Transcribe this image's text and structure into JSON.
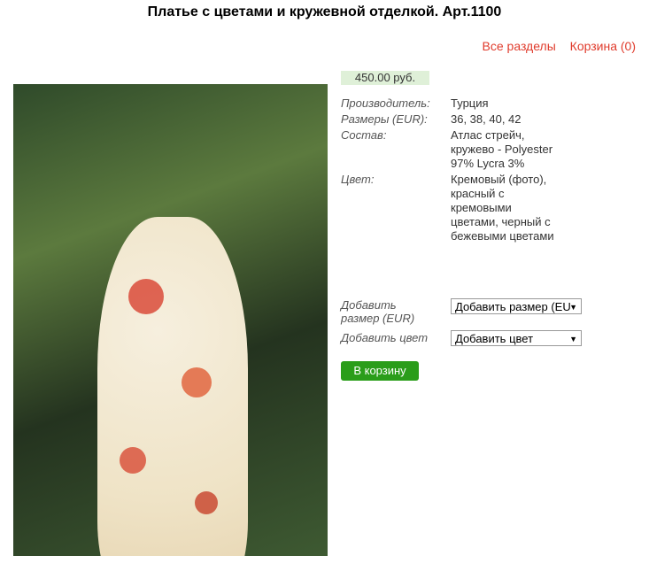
{
  "page": {
    "title": "Платье с цветами и кружевной отделкой. Арт.1100"
  },
  "nav": {
    "all_sections": "Все разделы",
    "cart": "Корзина (0)"
  },
  "product": {
    "price": "450.00 руб.",
    "specs": [
      {
        "label": "Производитель:",
        "value": "Турция"
      },
      {
        "label": "Размеры (EUR):",
        "value": "36, 38, 40, 42"
      },
      {
        "label": "Состав:",
        "value": "Атлас стрейч, кружево - Polyester 97% Lycra 3%"
      },
      {
        "label": "Цвет:",
        "value": "Кремовый (фото), красный с кремовыми цветами, черный с бежевыми цветами"
      }
    ],
    "add_size_label": "Добавить размер (EUR)",
    "add_size_select": "Добавить размер (EU",
    "add_color_label": "Добавить цвет",
    "add_color_select": "Добавить цвет",
    "cart_button": "В корзину"
  },
  "colors": {
    "link": "#e03b2c",
    "price_bg": "#dff0d8",
    "cart_button_bg": "#2a9d1a"
  },
  "icons": {
    "select_arrow": "chevron-down-icon"
  }
}
